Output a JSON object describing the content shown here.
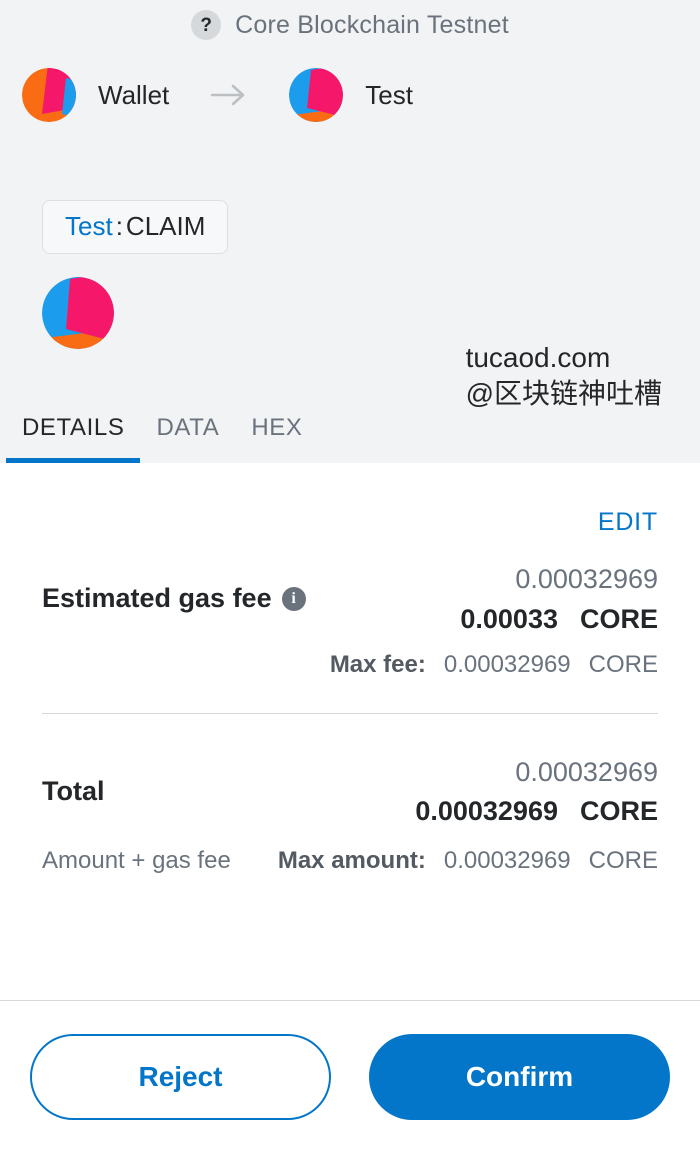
{
  "header": {
    "help_icon": "question-mark-icon",
    "network_name": "Core Blockchain Testnet",
    "from": {
      "account_name": "Wallet",
      "identicon": "jazzicon-orange"
    },
    "transfer_arrow": "arrow-right-icon",
    "to": {
      "account_name": "Test",
      "identicon": "jazzicon-blue"
    }
  },
  "contract": {
    "origin": "Test",
    "separator": " : ",
    "method": "CLAIM",
    "identicon": "jazzicon-blue-large"
  },
  "watermark": {
    "line1": "tucaod.com",
    "line2": "@区块链神吐槽"
  },
  "tabs": [
    {
      "label": "DETAILS",
      "active": true
    },
    {
      "label": "DATA",
      "active": false
    },
    {
      "label": "HEX",
      "active": false
    }
  ],
  "details": {
    "edit_label": "EDIT",
    "gas_fee": {
      "label": "Estimated gas fee",
      "info_icon": "info-icon",
      "fiat_value": "0.00032969",
      "native_value": "0.00033",
      "currency": "CORE",
      "max_label": "Max fee:",
      "max_value": "0.00032969",
      "max_currency": "CORE"
    },
    "total": {
      "label": "Total",
      "fiat_value": "0.00032969",
      "native_value": "0.00032969",
      "currency": "CORE",
      "subtitle": "Amount + gas fee",
      "max_label": "Max amount:",
      "max_value": "0.00032969",
      "max_currency": "CORE"
    }
  },
  "footer": {
    "reject_label": "Reject",
    "confirm_label": "Confirm"
  },
  "colors": {
    "accent_blue": "#0376c9",
    "header_bg": "#f2f3f4",
    "text_primary": "#24272a",
    "text_muted": "#6a737d",
    "identicon_pink": "#f5186a",
    "identicon_blue": "#1c9ced",
    "identicon_orange": "#f96c14"
  }
}
